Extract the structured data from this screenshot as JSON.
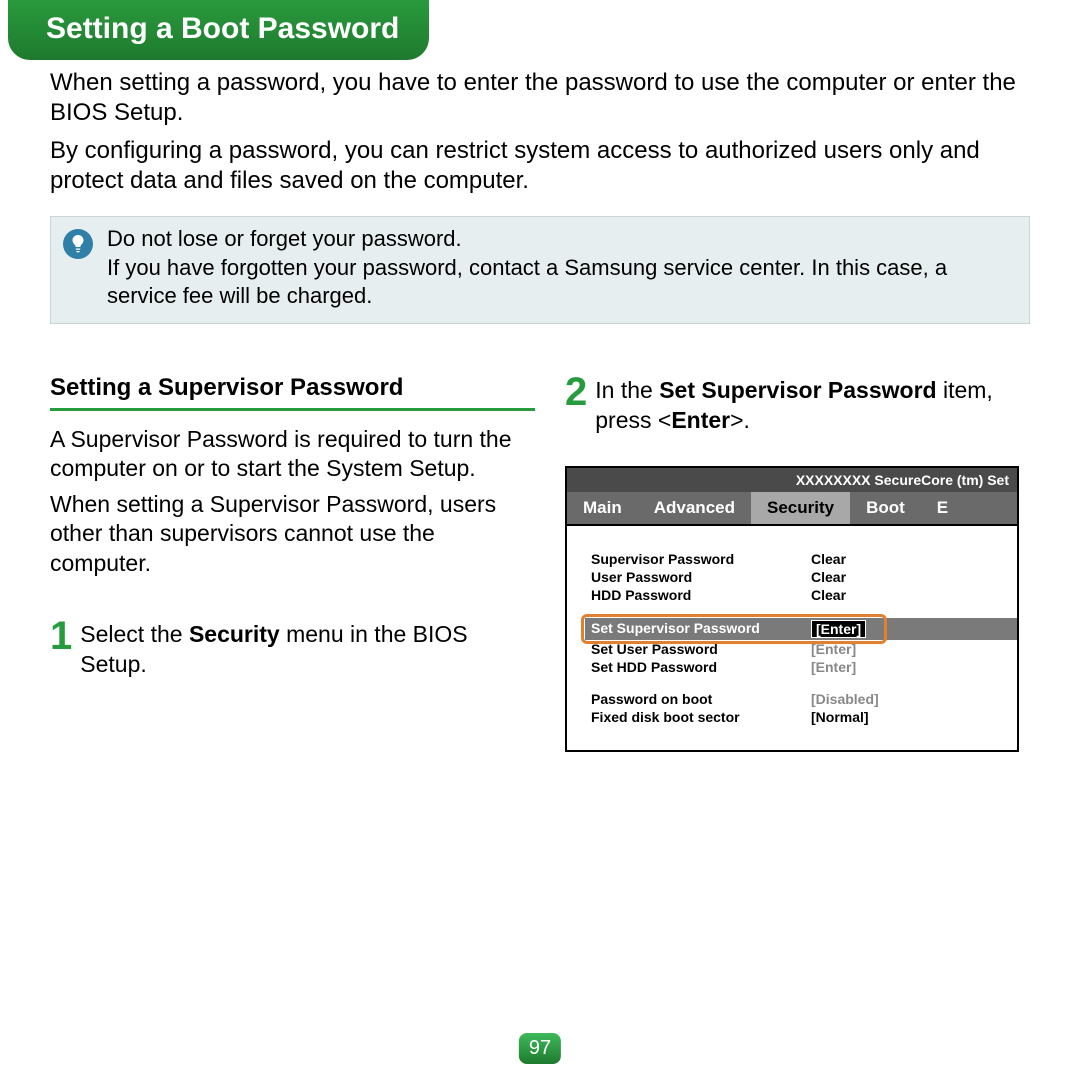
{
  "title": "Setting a Boot Password",
  "intro1": "When setting a password, you have to enter the password to use the computer or enter the BIOS Setup.",
  "intro2": "By configuring a password, you can restrict system access to authorized users only and protect data and files saved on the computer.",
  "tip_line1": "Do not lose or forget your password.",
  "tip_line2": "If you have forgotten your password, contact a Samsung service center. In this case, a service fee will be charged.",
  "left": {
    "heading": "Setting a Supervisor Password",
    "p1": "A Supervisor Password is required to turn the computer on or to start the System Setup.",
    "p2": "When setting a Supervisor Password, users other than supervisors cannot use the computer.",
    "step1_num": "1",
    "step1_pre": "Select the ",
    "step1_bold": "Security",
    "step1_post": " menu in the BIOS Setup."
  },
  "right": {
    "step2_num": "2",
    "step2_pre": "In the ",
    "step2_bold": "Set Supervisor Password",
    "step2_mid": " item, press <",
    "step2_bold2": "Enter",
    "step2_post": ">."
  },
  "bios": {
    "title": "XXXXXXXX SecureCore (tm) Set",
    "tabs": {
      "main": "Main",
      "advanced": "Advanced",
      "security": "Security",
      "boot": "Boot",
      "exit": "E"
    },
    "rows": {
      "supervisor": {
        "label": "Supervisor Password",
        "val": "Clear"
      },
      "user": {
        "label": "User Password",
        "val": "Clear"
      },
      "hdd": {
        "label": "HDD Password",
        "val": "Clear"
      },
      "set_sup": {
        "label": "Set Supervisor Password",
        "val": "[Enter]"
      },
      "set_user": {
        "label": "Set User Password",
        "val": "[Enter]"
      },
      "set_hdd": {
        "label": "Set HDD Password",
        "val": "[Enter]"
      },
      "pob": {
        "label": "Password on boot",
        "val": "[Disabled]"
      },
      "fdbs": {
        "label": "Fixed disk boot sector",
        "val": "[Normal]"
      }
    }
  },
  "page_number": "97"
}
